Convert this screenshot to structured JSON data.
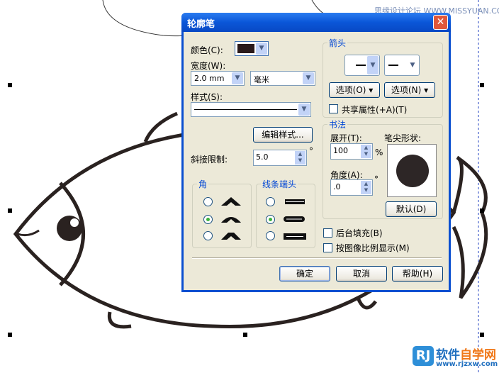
{
  "watermark": "思缘设计论坛 WWW.MISSYUAN.COM",
  "logo": {
    "mark": "RJ",
    "name_a": "软件",
    "name_b": "自学网",
    "url": "www.rjzxw.com"
  },
  "dialog": {
    "title": "轮廓笔",
    "close": "✕",
    "color_label": "颜色(C):",
    "color_value": "#2a1a1a",
    "width_label": "宽度(W):",
    "width_value": "2.0 mm",
    "unit_value": "毫米",
    "style_label": "样式(S):",
    "edit_style": "编辑样式...",
    "miter_label": "斜接限制:",
    "miter_value": "5.0",
    "degree": "°",
    "corners_title": "角",
    "caps_title": "线条端头",
    "arrows": {
      "title": "箭头",
      "options_left": "选项(O)",
      "options_right": "选项(N)",
      "share": "共享属性(+A)(T)"
    },
    "calligraphy": {
      "title": "书法",
      "stretch_label": "展开(T):",
      "stretch_value": "100",
      "percent": "%",
      "angle_label": "角度(A):",
      "angle_value": ".0",
      "nib_label": "笔尖形状:",
      "default": "默认(D)"
    },
    "behind_fill": "后台填充(B)",
    "scale_with_image": "按图像比例显示(M)",
    "ok": "确定",
    "cancel": "取消",
    "help": "帮助(H)"
  }
}
